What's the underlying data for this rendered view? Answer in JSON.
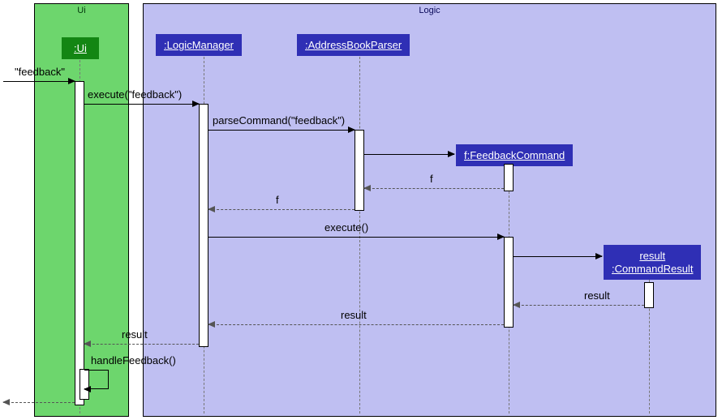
{
  "regions": {
    "ui_label": "Ui",
    "logic_label": "Logic"
  },
  "participants": {
    "ui": ":Ui",
    "logic_manager": ":LogicManager",
    "address_book_parser": ":AddressBookParser",
    "feedback_command": "f:FeedbackCommand",
    "command_result": "result\n:CommandResult"
  },
  "messages": {
    "m1": "\"feedback\"",
    "m2": "execute(\"feedback\")",
    "m3": "parseCommand(\"feedback\")",
    "m4_return": "f",
    "m5_return": "f",
    "m6": "execute()",
    "m7_return": "result",
    "m8_return": "result",
    "m9_return": "result",
    "m10_self": "handleFeedback()"
  },
  "chart_data": {
    "type": "uml-sequence-diagram",
    "regions": [
      {
        "name": "Ui",
        "color": "#6dd66d"
      },
      {
        "name": "Logic",
        "color": "#bfbff2"
      }
    ],
    "participants": [
      {
        "id": "external",
        "name": "(external caller)",
        "region": null
      },
      {
        "id": "ui",
        "name": ":Ui",
        "region": "Ui"
      },
      {
        "id": "lm",
        "name": ":LogicManager",
        "region": "Logic"
      },
      {
        "id": "ap",
        "name": ":AddressBookParser",
        "region": "Logic"
      },
      {
        "id": "fc",
        "name": "f:FeedbackCommand",
        "region": "Logic",
        "created_by": "ap"
      },
      {
        "id": "cr",
        "name": "result:CommandResult",
        "region": "Logic",
        "created_by": "fc"
      }
    ],
    "messages": [
      {
        "from": "external",
        "to": "ui",
        "label": "\"feedback\"",
        "type": "sync"
      },
      {
        "from": "ui",
        "to": "lm",
        "label": "execute(\"feedback\")",
        "type": "sync"
      },
      {
        "from": "lm",
        "to": "ap",
        "label": "parseCommand(\"feedback\")",
        "type": "sync"
      },
      {
        "from": "ap",
        "to": "fc",
        "label": "",
        "type": "create"
      },
      {
        "from": "fc",
        "to": "ap",
        "label": "f",
        "type": "return"
      },
      {
        "from": "ap",
        "to": "lm",
        "label": "f",
        "type": "return"
      },
      {
        "from": "lm",
        "to": "fc",
        "label": "execute()",
        "type": "sync"
      },
      {
        "from": "fc",
        "to": "cr",
        "label": "",
        "type": "create"
      },
      {
        "from": "cr",
        "to": "fc",
        "label": "result",
        "type": "return"
      },
      {
        "from": "fc",
        "to": "lm",
        "label": "result",
        "type": "return"
      },
      {
        "from": "lm",
        "to": "ui",
        "label": "result",
        "type": "return"
      },
      {
        "from": "ui",
        "to": "ui",
        "label": "handleFeedback()",
        "type": "self"
      },
      {
        "from": "ui",
        "to": "external",
        "label": "",
        "type": "return"
      }
    ]
  }
}
